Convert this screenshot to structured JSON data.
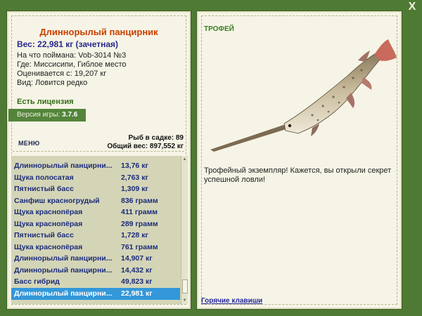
{
  "window": {
    "close_label": "X"
  },
  "catch": {
    "title": "Длиннорылый панцирник",
    "weight": "Вес: 22,981 кг (зачетная)",
    "lines": [
      "На что поймана: Vob-3014 №3",
      "Где: Миссисипи, Гиблое место",
      "Оценивается с: 19,207 кг",
      "Вид: Ловится редко"
    ],
    "license": "Есть лицензия",
    "version_label": "Версия игры:",
    "version_value": "3.7.6"
  },
  "menu": {
    "label": "МЕНЮ"
  },
  "stats": {
    "fish_count": "Рыб в садке: 89",
    "total_weight": "Общий вес: 897,552 кг"
  },
  "list": [
    {
      "name": "Длиннорылый панцирник",
      "weight": "13,76 кг"
    },
    {
      "name": "Щука полосатая",
      "weight": "2,763 кг"
    },
    {
      "name": "Пятнистый басс",
      "weight": "1,309 кг"
    },
    {
      "name": "Санфиш красногрудый",
      "weight": "836 грамм"
    },
    {
      "name": "Щука краснопёрая",
      "weight": "411 грамм"
    },
    {
      "name": "Щука краснопёрая",
      "weight": "289 грамм"
    },
    {
      "name": "Пятнистый басс",
      "weight": "1,728 кг"
    },
    {
      "name": "Щука краснопёрая",
      "weight": "761 грамм"
    },
    {
      "name": "Длиннорылый панцирник",
      "weight": "14,907 кг"
    },
    {
      "name": "Длиннорылый панцирник",
      "weight": "14,432 кг"
    },
    {
      "name": "Басс гибрид",
      "weight": "49,823 кг"
    },
    {
      "name": "Длиннорылый панцирник",
      "weight": "22,981 кг"
    }
  ],
  "list_truncated": [
    "Длиннорылый панцирни...",
    "Щука полосатая",
    "Пятнистый басс",
    "Санфиш красногрудый",
    "Щука краснопёрая",
    "Щука краснопёрая",
    "Пятнистый басс",
    "Щука краснопёрая",
    "Длиннорылый панцирни...",
    "Длиннорылый панцирни...",
    "Басс гибрид",
    "Длиннорылый панцирни..."
  ],
  "selected_index": 11,
  "trophy": {
    "label": "ТРОФЕЙ",
    "text": "Трофейный экземпляр! Кажется, вы открыли секрет успешной ловли!",
    "hotkeys": "Горячие клавиши",
    "image_icon": "longnose-gar-icon"
  },
  "colors": {
    "background": "#4f7a34",
    "panel": "#f6f4e6",
    "title": "#c74000",
    "weight": "#27298b",
    "selected_row": "#3397d9"
  }
}
